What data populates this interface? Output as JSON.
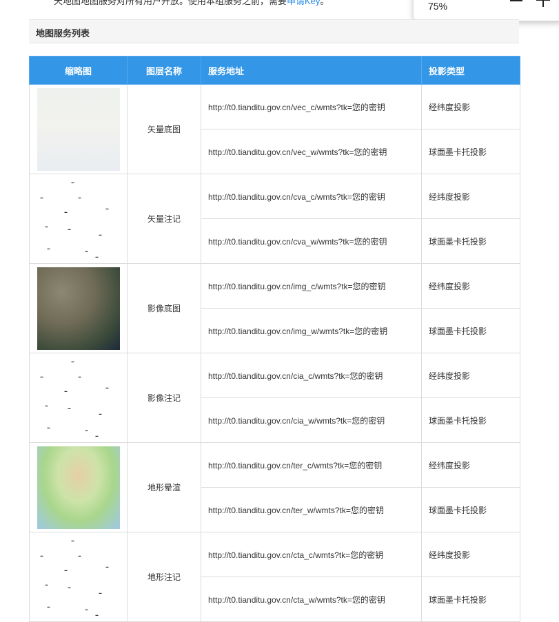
{
  "intro": {
    "text": "天地图地图服务对所有用户开放。使用本组服务之前，需要",
    "link": "申请Key",
    "suffix": "。"
  },
  "zoom": {
    "level": "75%"
  },
  "section_title": "地图服务列表",
  "table": {
    "headers": {
      "thumb": "缩略图",
      "name": "图层名称",
      "url": "服务地址",
      "proj": "投影类型"
    },
    "layers": [
      {
        "name": "矢量底图",
        "thumb": "vector-map",
        "rows": [
          {
            "url": "http://t0.tianditu.gov.cn/vec_c/wmts?tk=您的密钥",
            "proj": "经纬度投影"
          },
          {
            "url": "http://t0.tianditu.gov.cn/vec_w/wmts?tk=您的密钥",
            "proj": "球面墨卡托投影"
          }
        ]
      },
      {
        "name": "矢量注记",
        "thumb": "vector-annotation",
        "rows": [
          {
            "url": "http://t0.tianditu.gov.cn/cva_c/wmts?tk=您的密钥",
            "proj": "经纬度投影"
          },
          {
            "url": "http://t0.tianditu.gov.cn/cva_w/wmts?tk=您的密钥",
            "proj": "球面墨卡托投影"
          }
        ]
      },
      {
        "name": "影像底图",
        "thumb": "imagery-map",
        "rows": [
          {
            "url": "http://t0.tianditu.gov.cn/img_c/wmts?tk=您的密钥",
            "proj": "经纬度投影"
          },
          {
            "url": "http://t0.tianditu.gov.cn/img_w/wmts?tk=您的密钥",
            "proj": "球面墨卡托投影"
          }
        ]
      },
      {
        "name": "影像注记",
        "thumb": "imagery-annotation",
        "rows": [
          {
            "url": "http://t0.tianditu.gov.cn/cia_c/wmts?tk=您的密钥",
            "proj": "经纬度投影"
          },
          {
            "url": "http://t0.tianditu.gov.cn/cia_w/wmts?tk=您的密钥",
            "proj": "球面墨卡托投影"
          }
        ]
      },
      {
        "name": "地形晕渲",
        "thumb": "terrain-map",
        "rows": [
          {
            "url": "http://t0.tianditu.gov.cn/ter_c/wmts?tk=您的密钥",
            "proj": "经纬度投影"
          },
          {
            "url": "http://t0.tianditu.gov.cn/ter_w/wmts?tk=您的密钥",
            "proj": "球面墨卡托投影"
          }
        ]
      },
      {
        "name": "地形注记",
        "thumb": "terrain-annotation",
        "rows": [
          {
            "url": "http://t0.tianditu.gov.cn/cta_c/wmts?tk=您的密钥",
            "proj": "经纬度投影"
          },
          {
            "url": "http://t0.tianditu.gov.cn/cta_w/wmts?tk=您的密钥",
            "proj": "球面墨卡托投影"
          }
        ]
      }
    ]
  },
  "colors": {
    "header_bg": "#3396e6",
    "link": "#1e88e5"
  }
}
